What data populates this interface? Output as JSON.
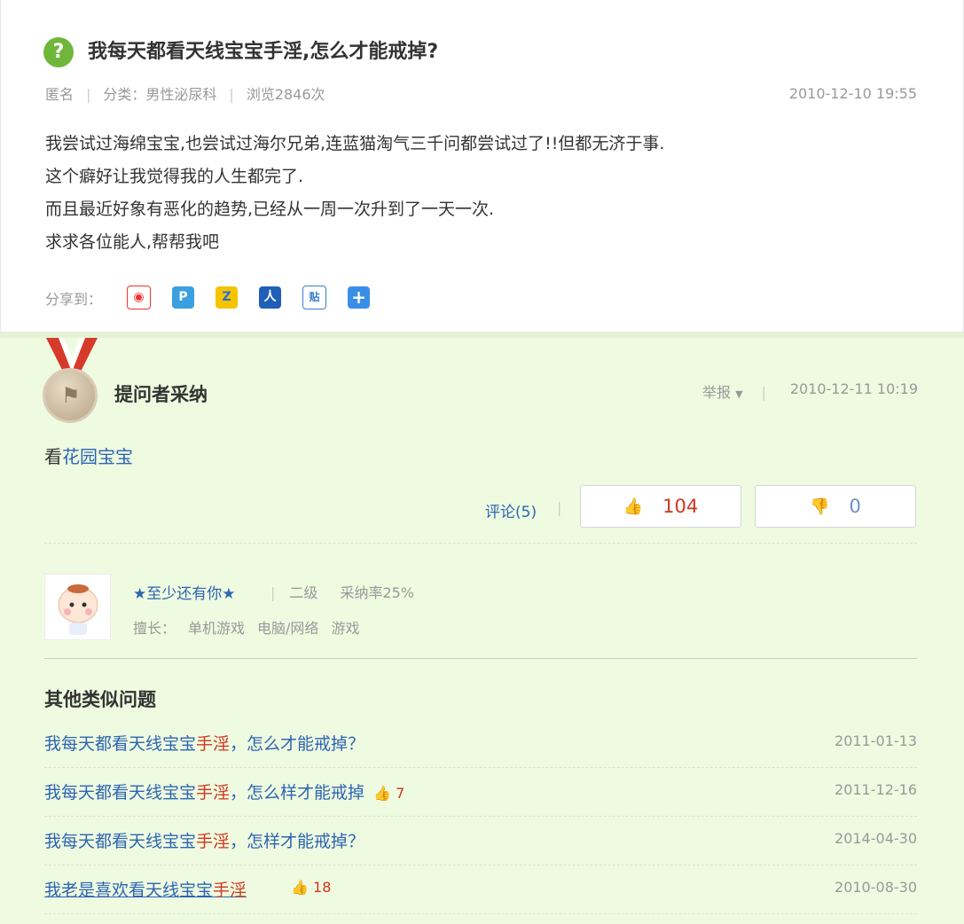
{
  "question": {
    "icon": "?",
    "title": "我每天都看天线宝宝手淫,怎么才能戒掉?",
    "author": "匿名",
    "category": "分类：男性泌尿科",
    "views": "浏览2846次",
    "date": "2010-12-10 19:55",
    "body": [
      "我尝试过海绵宝宝,也尝试过海尔兄弟,连蓝猫淘气三千问都尝试过了!!但都无济于事.",
      "这个癖好让我觉得我的人生都完了.",
      "而且最近好象有恶化的趋势,已经从一周一次升到了一天一次.",
      "求求各位能人,帮帮我吧"
    ],
    "share_label": "分享到：",
    "share_icons": [
      "weibo-icon",
      "qzone-icon",
      "qq-icon",
      "renren-icon",
      "tieba-icon",
      "plus-icon"
    ]
  },
  "answer": {
    "title": "提问者采纳",
    "report": "举报",
    "date": "2010-12-11 10:19",
    "text_prefix": "看",
    "text_link": "花园宝宝",
    "comment": "评论(5)",
    "up_count": "104",
    "down_count": "0"
  },
  "user": {
    "name": "★至少还有你★",
    "level": "二级",
    "adopt_rate": "采纳率25%",
    "skill_label": "擅长：",
    "skills": [
      "单机游戏",
      "电脑/网络",
      "游戏"
    ]
  },
  "similar": {
    "title": "其他类似问题",
    "items": [
      {
        "pre": "我每天都看天线宝宝",
        "hl": "手淫",
        "post": "，怎么才能戒掉？",
        "thumbs": "",
        "date": "2011-01-13"
      },
      {
        "pre": "我每天都看天线宝宝",
        "hl": "手淫",
        "post": "，怎么样才能戒掉",
        "thumbs": "7",
        "date": "2011-12-16"
      },
      {
        "pre": "我每天都看天线宝宝",
        "hl": "手淫",
        "post": "，怎样才能戒掉？",
        "thumbs": "",
        "date": "2014-04-30"
      },
      {
        "pre": "我老是喜欢看天线宝宝",
        "hl": "手淫",
        "post": " ",
        "thumbs": "18",
        "date": "2010-08-30"
      }
    ]
  },
  "colors": {
    "link": "#2d64b3",
    "highlight": "#d0361e",
    "answer_bg": "#eefbe0",
    "question_icon": "#6fb73a"
  }
}
